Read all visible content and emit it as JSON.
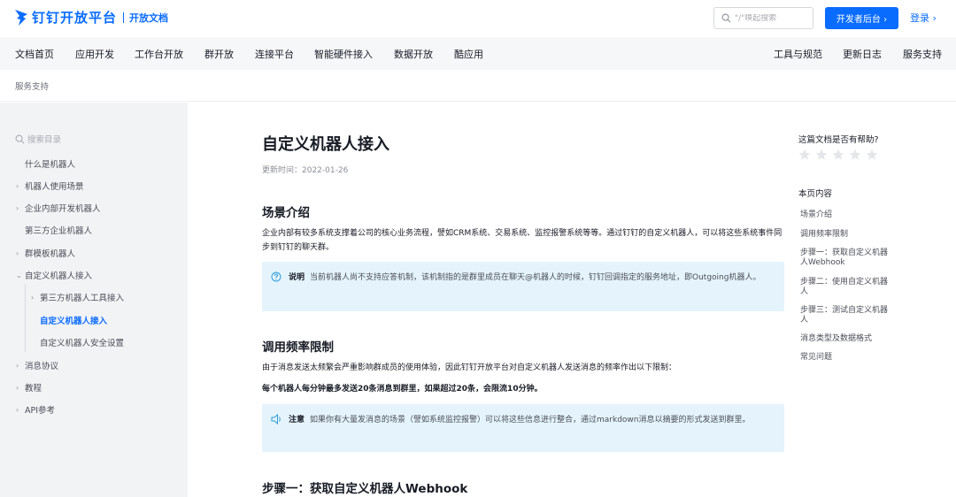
{
  "header": {
    "logo_text": "钉钉开放平台",
    "logo_sub": "开放文档",
    "search_placeholder": "\"/\"唤起搜索",
    "dev_button": "开发者后台 ›",
    "login": "登录 ›"
  },
  "nav": {
    "left": [
      "文档首页",
      "应用开发",
      "工作台开放",
      "群开放",
      "连接平台",
      "智能硬件接入",
      "数据开放",
      "酷应用"
    ],
    "right": [
      "工具与规范",
      "更新日志",
      "服务支持"
    ]
  },
  "breadcrumb": "服务支持",
  "sidebar": {
    "search_placeholder": "搜索目录",
    "items": [
      {
        "label": "什么是机器人",
        "chevron": ""
      },
      {
        "label": "机器人使用场景",
        "chevron": "›"
      },
      {
        "label": "企业内部开发机器人",
        "chevron": "›"
      },
      {
        "label": "第三方企业机器人",
        "chevron": ""
      },
      {
        "label": "群模板机器人",
        "chevron": "›"
      },
      {
        "label": "自定义机器人接入",
        "chevron": "⌄"
      },
      {
        "label": "第三方机器人工具接入",
        "chevron": "›"
      },
      {
        "label": "自定义机器人接入",
        "chevron": ""
      },
      {
        "label": "自定义机器人安全设置",
        "chevron": ""
      },
      {
        "label": "消息协议",
        "chevron": "›"
      },
      {
        "label": "教程",
        "chevron": "›"
      },
      {
        "label": "API参考",
        "chevron": "›"
      }
    ]
  },
  "article": {
    "title": "自定义机器人接入",
    "updated": "更新时间：2022-01-26",
    "section1": {
      "heading": "场景介绍",
      "text": "企业内部有较多系统支撑着公司的核心业务流程，譬如CRM系统、交易系统、监控报警系统等等。通过钉钉的自定义机器人，可以将这些系统事件同步到钉钉的聊天群。",
      "note_label": "说明",
      "note_text": "当前机器人尚不支持应答机制，该机制指的是群里成员在聊天@机器人的时候，钉钉回调指定的服务地址，即Outgoing机器人。"
    },
    "section2": {
      "heading": "调用频率限制",
      "text": "由于消息发送太频繁会严重影响群成员的使用体验，因此钉钉开放平台对自定义机器人发送消息的频率作出以下限制：",
      "bold_text": "每个机器人每分钟最多发送20条消息到群里，如果超过20条，会限流10分钟。",
      "note_label": "注意",
      "note_text": "如果你有大量发消息的场景（譬如系统监控报警）可以将这些信息进行整合，通过markdown消息以摘要的形式发送到群里。"
    },
    "section3": {
      "heading": "步骤一：获取自定义机器人Webhook"
    }
  },
  "toc": {
    "helpful": "这篇文档是否有帮助?",
    "rating": 0,
    "title": "本页内容",
    "items": [
      "场景介绍",
      "调用频率限制",
      "步骤一：获取自定义机器人Webhook",
      "步骤二：使用自定义机器人",
      "步骤三：测试自定义机器人",
      "消息类型及数据格式",
      "常见问题"
    ]
  },
  "colors": {
    "brand": "#0a6cff",
    "note_bg": "#e5f4fc",
    "sidebar_bg": "#f2f3f5"
  }
}
